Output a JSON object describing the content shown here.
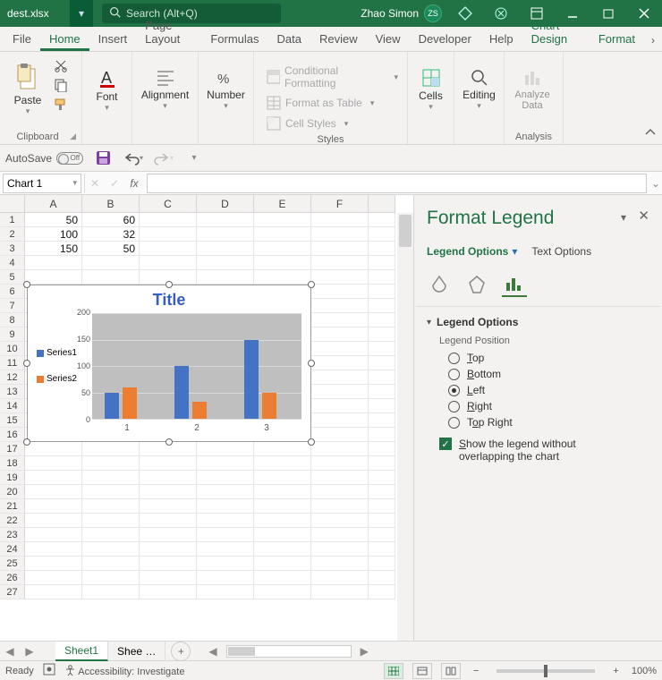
{
  "titlebar": {
    "filename": "dest.xlsx",
    "search_placeholder": "Search (Alt+Q)",
    "user": "Zhao Simon",
    "user_initials": "ZS"
  },
  "tabs": [
    "File",
    "Home",
    "Insert",
    "Page Layout",
    "Formulas",
    "Data",
    "Review",
    "View",
    "Developer",
    "Help",
    "Chart Design",
    "Format"
  ],
  "active_tab": "Home",
  "ribbon": {
    "clipboard": {
      "label": "Clipboard",
      "paste": "Paste"
    },
    "font": {
      "label": "Font",
      "btn": "Font"
    },
    "alignment": {
      "label": "Alignment",
      "btn": "Alignment"
    },
    "number": {
      "label": "Number",
      "btn": "Number"
    },
    "styles": {
      "label": "Styles",
      "cf": "Conditional Formatting",
      "fat": "Format as Table",
      "cs": "Cell Styles"
    },
    "cells": {
      "label": "Cells",
      "btn": "Cells"
    },
    "editing": {
      "label": "Editing",
      "btn": "Editing"
    },
    "analysis": {
      "label": "Analysis",
      "btn": "Analyze Data"
    }
  },
  "qat": {
    "autosave": "AutoSave",
    "switch": "Off"
  },
  "namebox": "Chart 1",
  "grid": {
    "cols": [
      "A",
      "B",
      "C",
      "D",
      "E",
      "F"
    ],
    "rows": 27,
    "cells": {
      "A1": "50",
      "B1": "60",
      "A2": "100",
      "B2": "32",
      "A3": "150",
      "B3": "50"
    }
  },
  "chart_data": {
    "type": "bar",
    "title": "Title",
    "categories": [
      "1",
      "2",
      "3"
    ],
    "series": [
      {
        "name": "Series1",
        "values": [
          50,
          100,
          150
        ],
        "color": "#4472C4"
      },
      {
        "name": "Series2",
        "values": [
          60,
          32,
          50
        ],
        "color": "#ED7D31"
      }
    ],
    "ylim": [
      0,
      200
    ],
    "ystep": 50,
    "legend_position": "left"
  },
  "sheets": {
    "tabs": [
      "Sheet1",
      "Shee …"
    ],
    "active": 0
  },
  "status": {
    "ready": "Ready",
    "acc": "Accessibility: Investigate",
    "zoom": "100%"
  },
  "pane": {
    "title": "Format Legend",
    "legend_options": "Legend Options",
    "text_options": "Text Options",
    "section": "Legend Options",
    "position_label": "Legend Position",
    "positions": [
      "Top",
      "Bottom",
      "Left",
      "Right",
      "Top Right"
    ],
    "selected": "Left",
    "overlap": "Show the legend without overlapping the chart",
    "overlap_checked": true
  }
}
